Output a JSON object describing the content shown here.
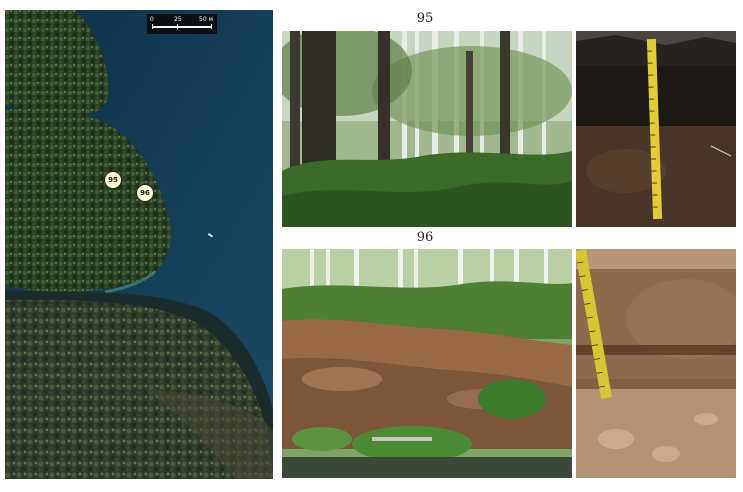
{
  "map": {
    "scale": {
      "labels": [
        "0",
        "25",
        "50 м"
      ]
    },
    "markers": [
      {
        "id": "95",
        "label": "95"
      },
      {
        "id": "96",
        "label": "96"
      }
    ]
  },
  "sites": [
    {
      "title": "95"
    },
    {
      "title": "96"
    }
  ],
  "colors": {
    "water": "#133a52",
    "forest": "#2f4a2a",
    "marker_fill": "#fff6d2"
  }
}
